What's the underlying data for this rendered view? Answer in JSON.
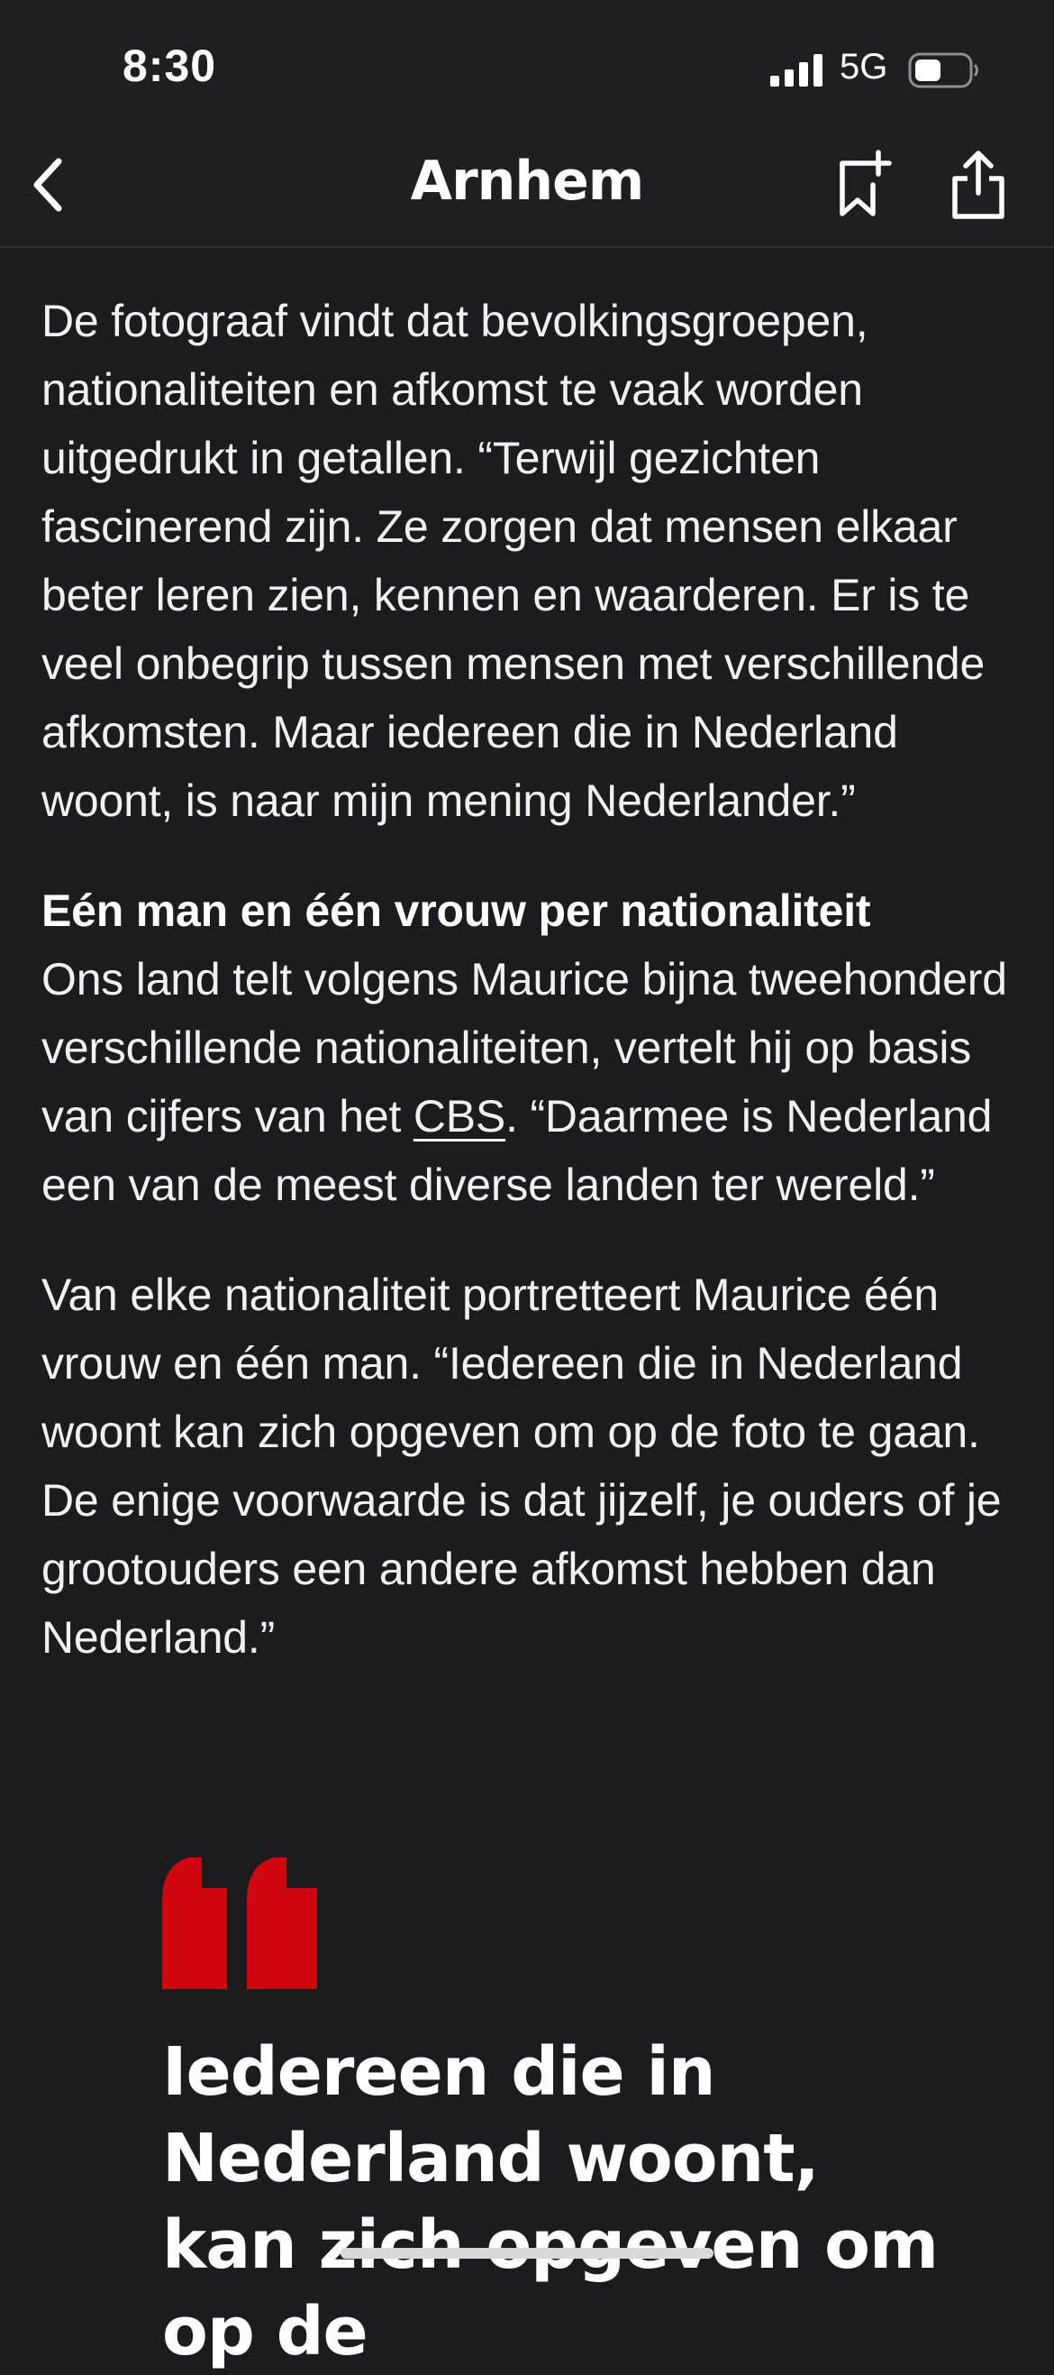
{
  "status_bar": {
    "time": "8:30",
    "network": "5G",
    "signal_icon": "cellular-signal-icon",
    "battery_icon": "battery-icon"
  },
  "nav": {
    "title": "Arnhem",
    "back_icon": "chevron-left-icon",
    "bookmark_icon": "bookmark-add-icon",
    "share_icon": "share-icon"
  },
  "article": {
    "paragraph_1": "De fotograaf vindt dat bevolkingsgroepen, nationaliteiten en afkomst te vaak worden uitgedrukt in getallen. “Terwijl gezichten fascinerend zijn. Ze zorgen dat mensen elkaar beter leren zien, kennen en waarderen. Er is te veel onbegrip tussen mensen met verschillende afkomsten. Maar iedereen die in Nederland woont, is naar mijn mening Nederlander.”",
    "heading": "Eén man en één vrouw per nationaliteit",
    "paragraph_2_before_link": "Ons land telt volgens Maurice bijna tweehonderd verschillende nationaliteiten, vertelt hij op basis van cijfers van het ",
    "paragraph_2_link": "CBS",
    "paragraph_2_after_link": ". “Daarmee is Nederland een van de meest diverse landen ter wereld.”",
    "paragraph_3": "Van elke nationaliteit portretteert Maurice één vrouw en één man. “Iedereen die in Nederland woont kan zich opgeven om op de foto te gaan. De enige voorwaarde is dat jijzelf, je ouders of je grootouders een andere afkomst hebben dan Nederland.”"
  },
  "quote": {
    "text": "Iedereen die in Nederland woont, kan zich opgeven om op de",
    "mark_color": "#d0060f",
    "mark_icon": "quote-mark-icon"
  },
  "colors": {
    "background": "#1c1c1e",
    "text": "#f1f1f1",
    "accent": "#d0060f"
  }
}
